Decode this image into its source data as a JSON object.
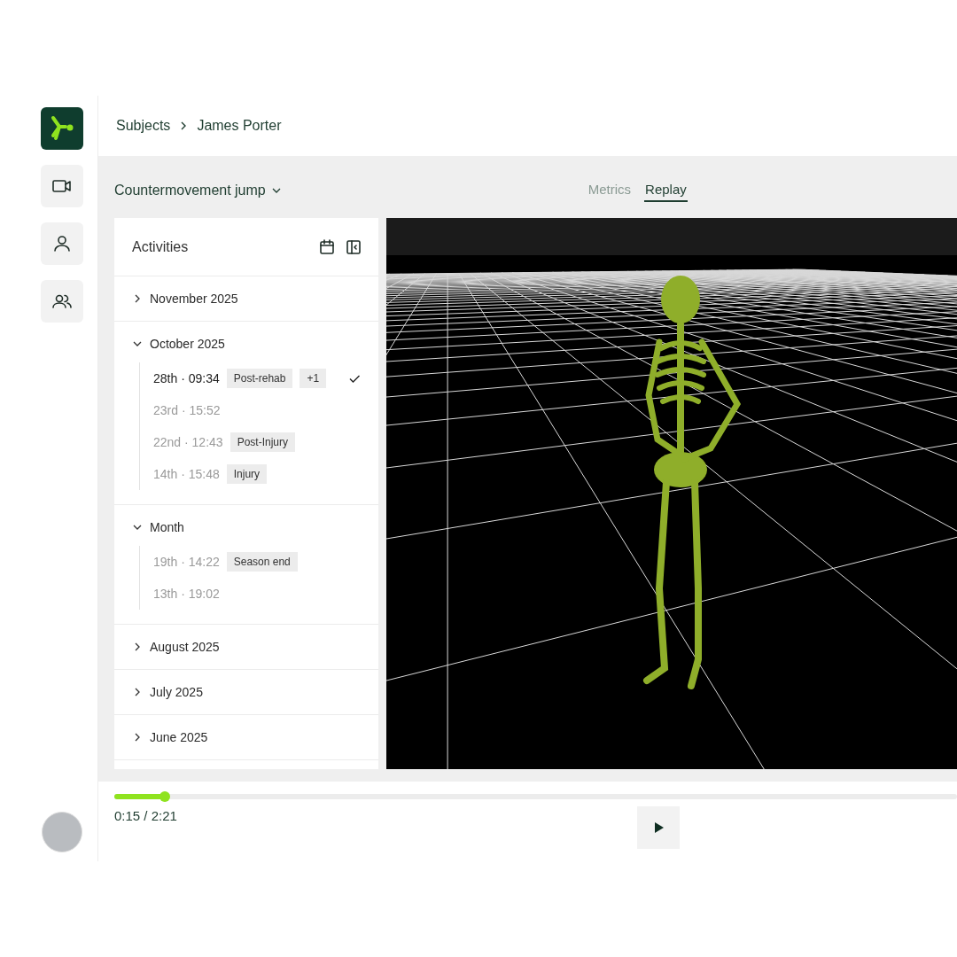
{
  "breadcrumb": [
    {
      "label": "Subjects"
    },
    {
      "label": "James Porter"
    }
  ],
  "sidebar": {
    "items": [
      {
        "kind": "video",
        "selected": false
      },
      {
        "kind": "person",
        "selected": false
      },
      {
        "kind": "people",
        "selected": false
      }
    ]
  },
  "exercise_select": {
    "value": "Countermovement jump"
  },
  "tabs": [
    {
      "label": "Metrics",
      "selected": false
    },
    {
      "label": "Replay",
      "selected": true
    }
  ],
  "activities": {
    "title": "Activities",
    "groups": [
      {
        "label": "November 2025",
        "expanded": false
      },
      {
        "label": "October 2025",
        "expanded": true,
        "items": [
          {
            "label": "28th · 09:34",
            "tags": [
              "Post-rehab",
              "+1"
            ],
            "selected": true
          },
          {
            "label": "23rd · 15:52",
            "selected": false
          },
          {
            "label": "22nd · 12:43",
            "tags": [
              "Post-Injury"
            ],
            "selected": false
          },
          {
            "label": "14th · 15:48",
            "tags": [
              "Injury"
            ],
            "selected": false
          }
        ]
      },
      {
        "label": "Month",
        "expanded": true,
        "items": [
          {
            "label": "19th · 14:22",
            "tags": [
              "Season end"
            ],
            "selected": false
          },
          {
            "label": "13th · 19:02",
            "selected": false
          }
        ]
      },
      {
        "label": "August 2025",
        "expanded": false
      },
      {
        "label": "July 2025",
        "expanded": false
      },
      {
        "label": "June 2025",
        "expanded": false
      }
    ]
  },
  "playback": {
    "level": 0.06,
    "time": "0:15 / 2:21"
  }
}
